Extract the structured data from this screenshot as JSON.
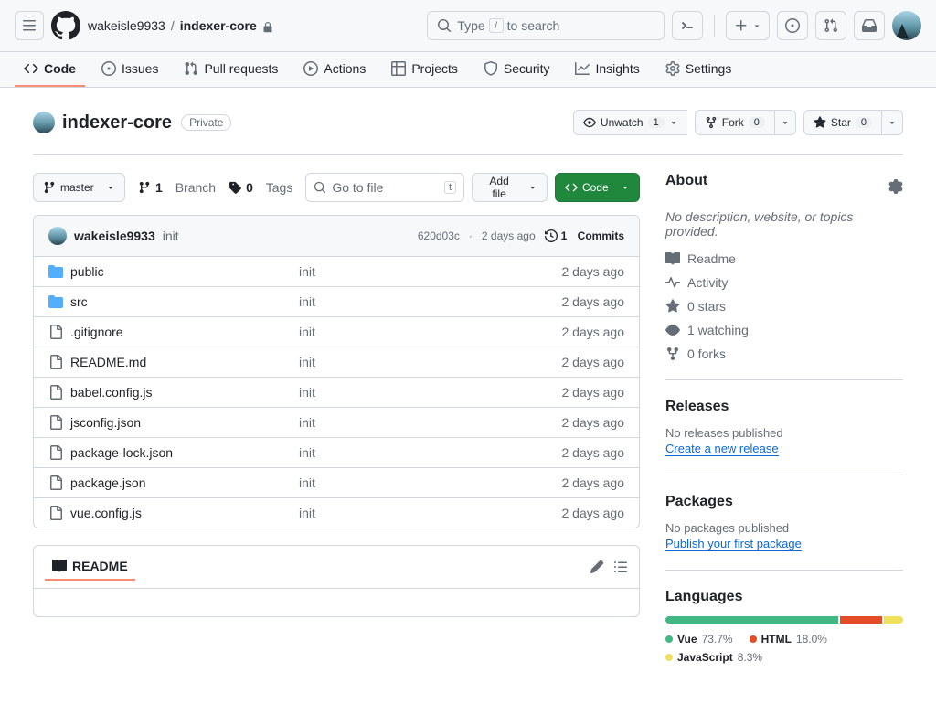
{
  "header": {
    "owner": "wakeisle9933",
    "repo": "indexer-core",
    "search_placeholder": "Type",
    "search_hint": "to search",
    "slash": "/"
  },
  "nav": {
    "code": "Code",
    "issues": "Issues",
    "pr": "Pull requests",
    "actions": "Actions",
    "projects": "Projects",
    "security": "Security",
    "insights": "Insights",
    "settings": "Settings"
  },
  "repo": {
    "name": "indexer-core",
    "visibility": "Private",
    "unwatch": "Unwatch",
    "unwatch_count": "1",
    "fork": "Fork",
    "fork_count": "0",
    "star": "Star",
    "star_count": "0"
  },
  "file_nav": {
    "branch": "master",
    "branch_count": "1",
    "branch_label": "Branch",
    "tags_count": "0",
    "tags_label": "Tags",
    "go_to_file": "Go to file",
    "go_key": "t",
    "add_file": "Add file",
    "code_btn": "Code"
  },
  "commit": {
    "author": "wakeisle9933",
    "message": "init",
    "sha": "620d03c",
    "time": "2 days ago",
    "commits_count": "1",
    "commits_label": "Commits"
  },
  "files": [
    {
      "type": "dir",
      "name": "public",
      "msg": "init",
      "time": "2 days ago"
    },
    {
      "type": "dir",
      "name": "src",
      "msg": "init",
      "time": "2 days ago"
    },
    {
      "type": "file",
      "name": ".gitignore",
      "msg": "init",
      "time": "2 days ago"
    },
    {
      "type": "file",
      "name": "README.md",
      "msg": "init",
      "time": "2 days ago"
    },
    {
      "type": "file",
      "name": "babel.config.js",
      "msg": "init",
      "time": "2 days ago"
    },
    {
      "type": "file",
      "name": "jsconfig.json",
      "msg": "init",
      "time": "2 days ago"
    },
    {
      "type": "file",
      "name": "package-lock.json",
      "msg": "init",
      "time": "2 days ago"
    },
    {
      "type": "file",
      "name": "package.json",
      "msg": "init",
      "time": "2 days ago"
    },
    {
      "type": "file",
      "name": "vue.config.js",
      "msg": "init",
      "time": "2 days ago"
    }
  ],
  "readme": {
    "label": "README"
  },
  "about": {
    "title": "About",
    "desc": "No description, website, or topics provided.",
    "readme": "Readme",
    "activity": "Activity",
    "stars": "0 stars",
    "watching": "1 watching",
    "forks": "0 forks"
  },
  "releases": {
    "title": "Releases",
    "none": "No releases published",
    "link": "Create a new release"
  },
  "packages": {
    "title": "Packages",
    "none": "No packages published",
    "link": "Publish your first package"
  },
  "languages": {
    "title": "Languages",
    "items": [
      {
        "name": "Vue",
        "pct": "73.7%",
        "color": "#41b883",
        "width": 73.7
      },
      {
        "name": "HTML",
        "pct": "18.0%",
        "color": "#e34c26",
        "width": 18.0
      },
      {
        "name": "JavaScript",
        "pct": "8.3%",
        "color": "#f1e05a",
        "width": 8.3
      }
    ]
  }
}
